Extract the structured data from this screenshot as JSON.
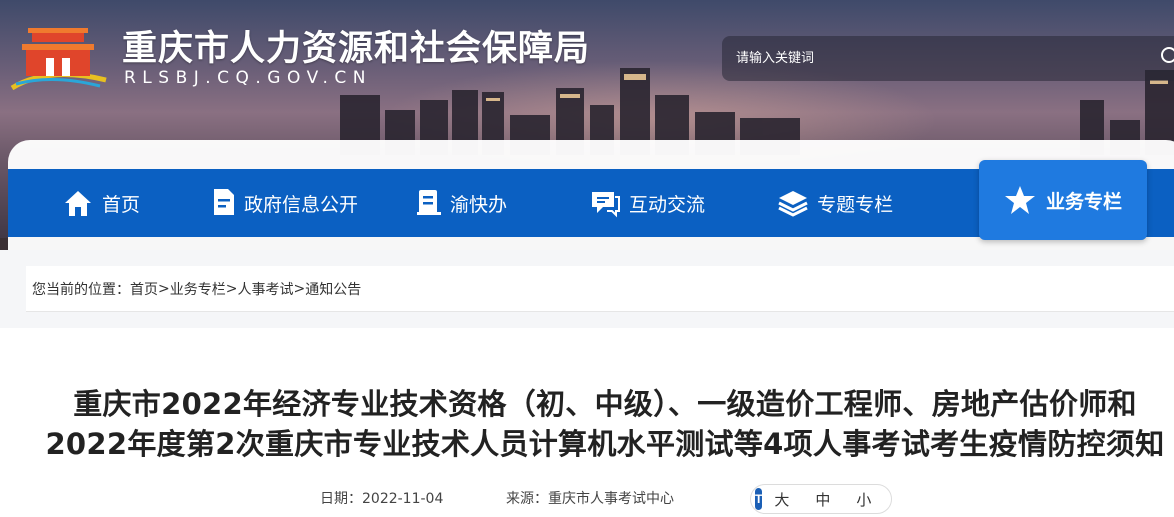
{
  "header": {
    "site_title": "重庆市人力资源和社会保障局",
    "site_domain": "RLSBJ.CQ.GOV.CN",
    "logo_icon": "tiananmen-emblem-icon",
    "search": {
      "placeholder": "请输入关键词",
      "icon": "search-icon"
    }
  },
  "nav": {
    "items": [
      {
        "label": "首页",
        "icon": "home-icon"
      },
      {
        "label": "政府信息公开",
        "icon": "document-icon"
      },
      {
        "label": "渝快办",
        "icon": "clipboard-icon"
      },
      {
        "label": "互动交流",
        "icon": "chat-icon"
      },
      {
        "label": "专题专栏",
        "icon": "layers-icon"
      }
    ],
    "active": {
      "label": "业务专栏",
      "icon": "star-icon"
    }
  },
  "breadcrumb": {
    "prefix": "您当前的位置：",
    "items": [
      "首页",
      "业务专栏",
      "人事考试",
      "通知公告"
    ],
    "separator": ">"
  },
  "article": {
    "title_line1": "重庆市2022年经济专业技术资格（初、中级）、一级造价工程师、房地产估价师和",
    "title_line2": "2022年度第2次重庆市专业技术人员计算机水平测试等4项人事考试考生疫情防控须知",
    "date_label": "日期：",
    "date": "2022-11-04",
    "source_label": "来源：",
    "source": "重庆市人事考试中心",
    "font_size": {
      "icon_text": "T",
      "options": [
        "大",
        "中",
        "小"
      ]
    }
  },
  "colors": {
    "nav_bg": "#0b60c2",
    "nav_active_bg": "#1f7ae0",
    "text_primary": "#222222"
  }
}
